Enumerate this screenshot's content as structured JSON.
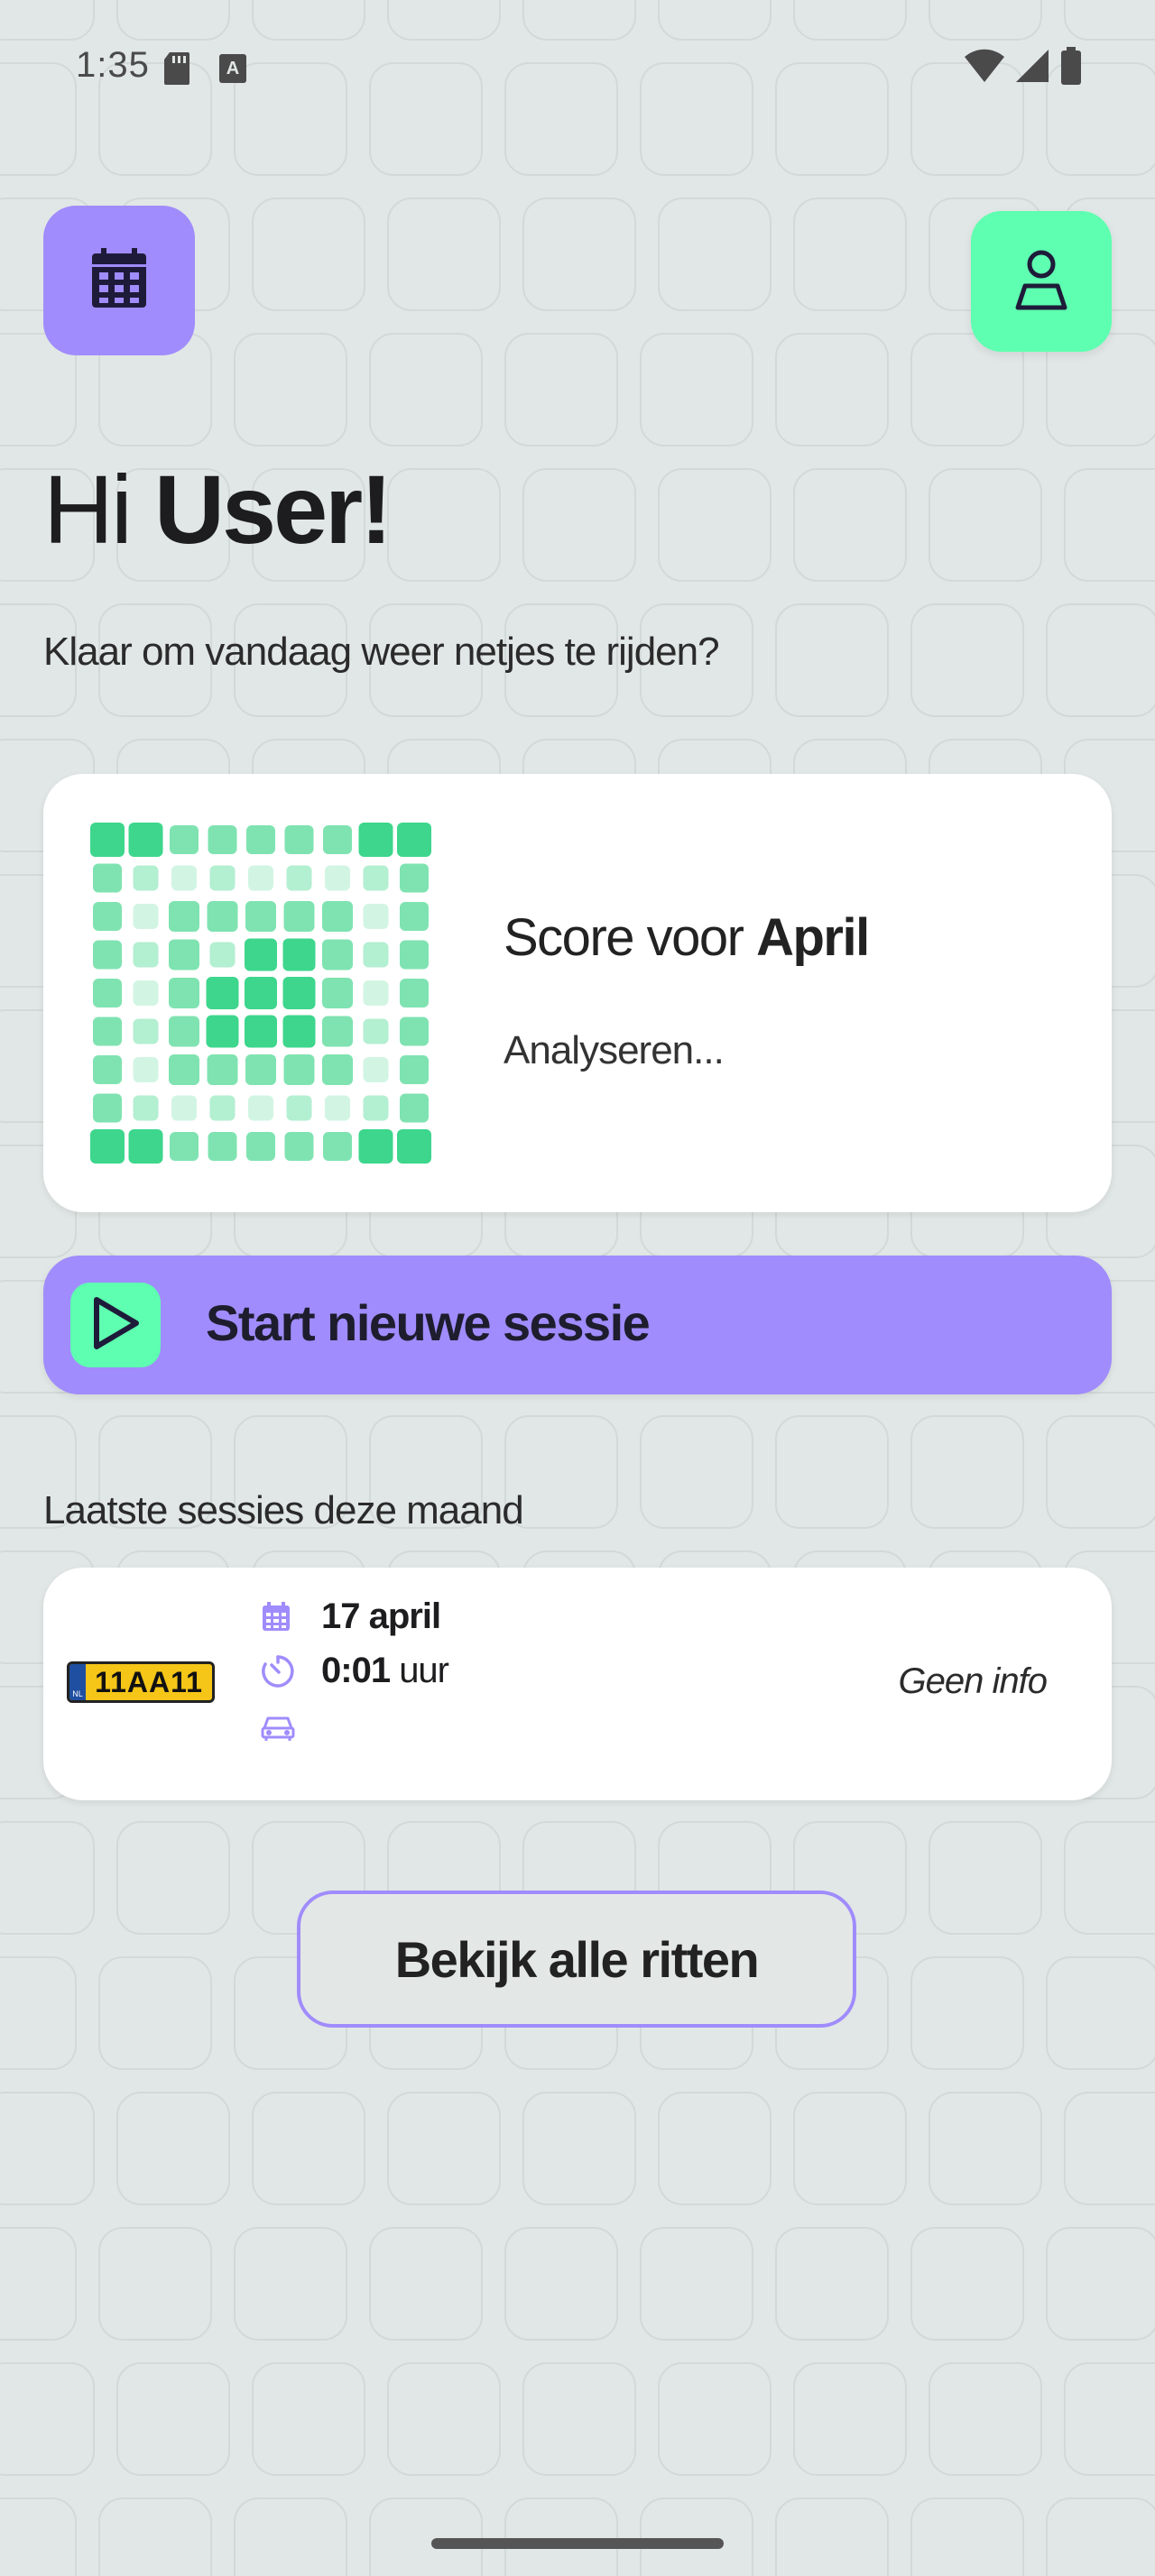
{
  "status_bar": {
    "time": "1:35",
    "icons": [
      "sd-card-icon",
      "keyboard-a-icon",
      "wifi-icon",
      "signal-icon",
      "battery-icon"
    ]
  },
  "header": {
    "calendar_icon": "calendar-icon",
    "profile_icon": "person-icon"
  },
  "greeting": {
    "hi": "Hi",
    "name": "User!"
  },
  "subtitle": "Klaar om vandaag weer netjes te rijden?",
  "score_card": {
    "title_prefix": "Score voor",
    "month": "April",
    "status": "Analyseren..."
  },
  "start_session": {
    "label": "Start nieuwe sessie",
    "icon": "play-icon"
  },
  "recent": {
    "title": "Laatste sessies deze maand",
    "sessions": [
      {
        "plate": "11AA11",
        "plate_country": "NL",
        "date": "17 april",
        "duration": "0:01",
        "duration_unit": "uur",
        "info": "Geen info"
      }
    ]
  },
  "view_all_label": "Bekijk alle ritten",
  "colors": {
    "purple": "#a08cfc",
    "mint": "#5effb0",
    "background": "#e1e7e6",
    "green_dark": "#3dd68c"
  }
}
